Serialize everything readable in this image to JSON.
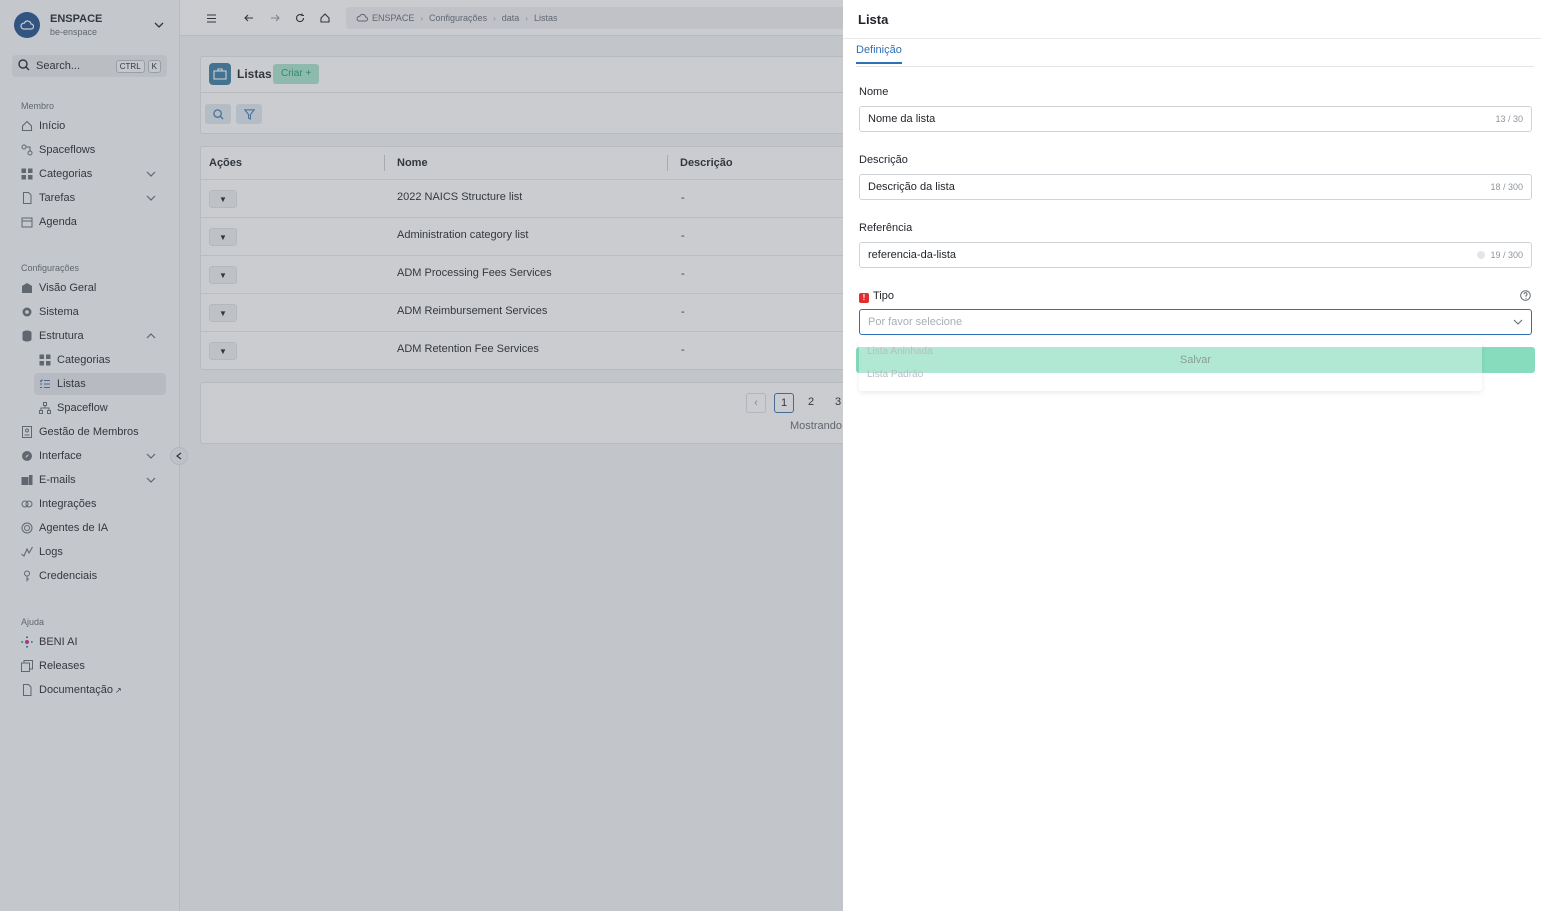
{
  "org": {
    "name": "ENSPACE",
    "slug": "be-enspace"
  },
  "search": {
    "label": "Search...",
    "kbd1": "CTRL",
    "kbd2": "K"
  },
  "sidebar": {
    "member_title": "Membro",
    "member_items": [
      {
        "label": "Início",
        "icon": "home-icon"
      },
      {
        "label": "Spaceflows",
        "icon": "flow-icon"
      },
      {
        "label": "Categorias",
        "icon": "grid-icon"
      },
      {
        "label": "Tarefas",
        "icon": "document-icon"
      },
      {
        "label": "Agenda",
        "icon": "calendar-icon"
      }
    ],
    "config_title": "Configurações",
    "config_items": [
      {
        "label": "Visão Geral",
        "icon": "building-icon"
      },
      {
        "label": "Sistema",
        "icon": "gear-icon"
      },
      {
        "label": "Estrutura",
        "icon": "database-icon"
      },
      {
        "label": "Categorias",
        "icon": "grid-icon"
      },
      {
        "label": "Listas",
        "icon": "list-icon"
      },
      {
        "label": "Spaceflow",
        "icon": "hierarchy-icon"
      },
      {
        "label": "Gestão de Membros",
        "icon": "id-card-icon"
      },
      {
        "label": "Interface",
        "icon": "compass-icon"
      },
      {
        "label": "E-mails",
        "icon": "mail-icon"
      },
      {
        "label": "Integrações",
        "icon": "integration-icon"
      },
      {
        "label": "Agentes de IA",
        "icon": "ai-agent-icon"
      },
      {
        "label": "Logs",
        "icon": "log-icon"
      },
      {
        "label": "Credenciais",
        "icon": "key-icon"
      }
    ],
    "help_title": "Ajuda",
    "help_items": [
      {
        "label": "BENI AI",
        "icon": "sparkle-icon"
      },
      {
        "label": "Releases",
        "icon": "release-icon"
      },
      {
        "label": "Documentação",
        "icon": "document-icon",
        "suffix": "↗"
      }
    ]
  },
  "breadcrumbs": [
    "ENSPACE",
    "Configurações",
    "data",
    "Listas"
  ],
  "list_panel": {
    "title": "Listas",
    "create_label": "Criar +"
  },
  "table": {
    "headers": [
      "Ações",
      "Nome",
      "Descrição"
    ],
    "rows": [
      {
        "name": "2022 NAICS Structure list",
        "description": "-"
      },
      {
        "name": "Administration category list",
        "description": "-"
      },
      {
        "name": "ADM Processing Fees Services",
        "description": "-"
      },
      {
        "name": "ADM Reimbursement Services",
        "description": "-"
      },
      {
        "name": "ADM Retention Fee Services",
        "description": "-"
      }
    ]
  },
  "pagination": {
    "prev": "‹",
    "pages": [
      "1",
      "2",
      "3"
    ],
    "current": "1",
    "info": "Mostrando"
  },
  "drawer": {
    "title": "Lista",
    "tab": "Definição",
    "fields": {
      "name": {
        "label": "Nome",
        "value": "Nome da lista",
        "count": "13 / 30"
      },
      "description": {
        "label": "Descrição",
        "value": "Descrição da lista",
        "count": "18 / 300"
      },
      "reference": {
        "label": "Referência",
        "value": "referencia-da-lista",
        "count": "19 / 300"
      },
      "type": {
        "label": "Tipo",
        "placeholder": "Por favor selecione",
        "options": [
          "Lista Aninhada",
          "Lista Padrão"
        ]
      }
    },
    "save_label": "Salvar"
  },
  "colors": {
    "accent": "#2f6fb5",
    "save": "#87dcbd",
    "required": "#e02d2d",
    "create": "#16a06c"
  }
}
